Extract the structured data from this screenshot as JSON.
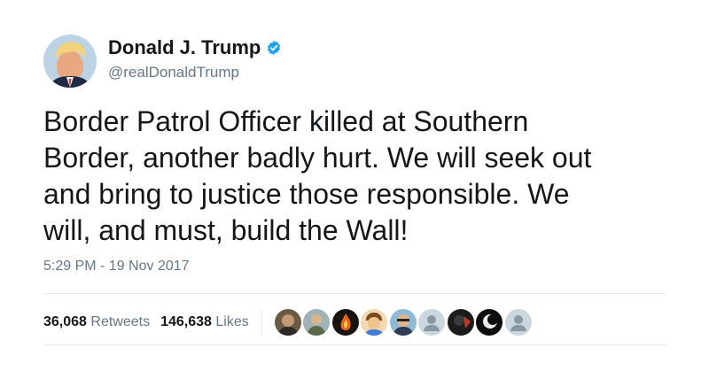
{
  "author": {
    "display_name": "Donald J. Trump",
    "handle": "@realDonaldTrump",
    "verified_icon": "verified-badge-icon",
    "verified_color": "#1da1f2"
  },
  "tweet": {
    "lines": [
      "Border Patrol Officer killed at Southern",
      "Border, another badly hurt. We will seek out",
      "and bring to justice those responsible. We",
      "will, and must, build the Wall!"
    ],
    "timestamp": "5:29 PM - 19 Nov 2017"
  },
  "stats": {
    "retweets_count": "36,068",
    "retweets_label": "Retweets",
    "likes_count": "146,638",
    "likes_label": "Likes"
  },
  "likers": {
    "avatar_count": 9
  },
  "colors": {
    "text": "#14171a",
    "secondary_text": "#657786",
    "divider": "#e6ecf0"
  }
}
